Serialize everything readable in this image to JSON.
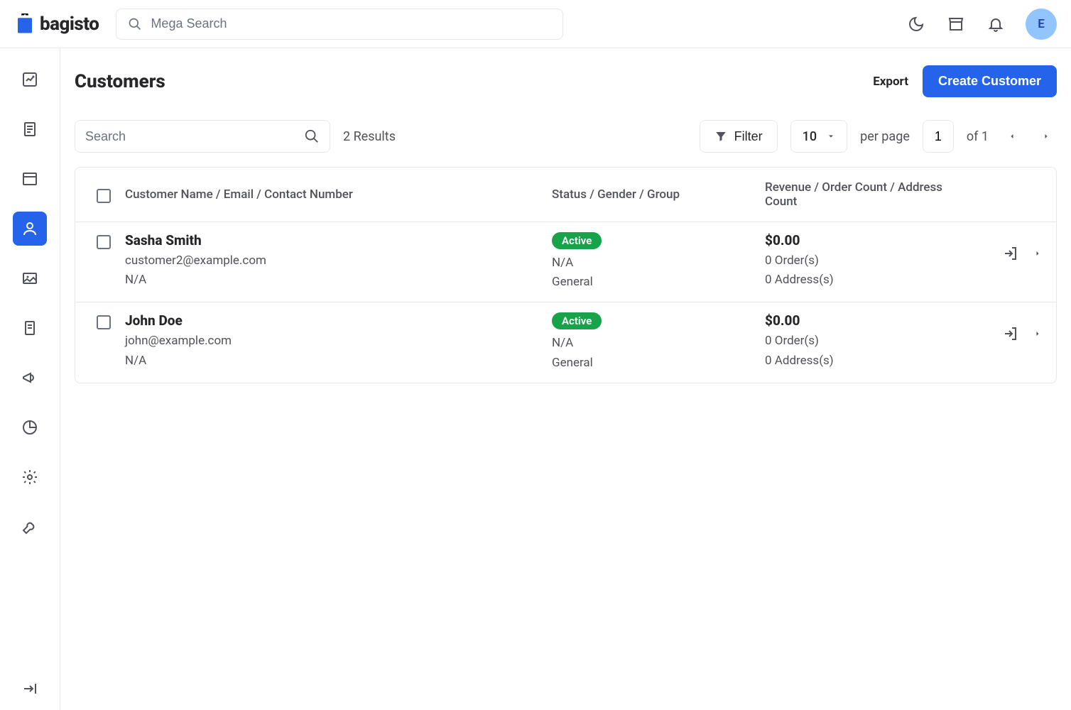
{
  "brand": "bagisto",
  "search": {
    "placeholder": "Mega Search"
  },
  "avatar_initial": "E",
  "page": {
    "title": "Customers"
  },
  "actions": {
    "export": "Export",
    "create": "Create Customer"
  },
  "toolbar": {
    "search_placeholder": "Search",
    "results": "2 Results",
    "filter": "Filter",
    "per_page_value": "10",
    "per_page_label": "per page",
    "page_current": "1",
    "of_label": "of",
    "page_total": "1"
  },
  "columns": {
    "name": "Customer Name / Email / Contact Number",
    "status": "Status / Gender / Group",
    "revenue": "Revenue / Order Count / Address Count"
  },
  "rows": [
    {
      "name": "Sasha Smith",
      "email": "customer2@example.com",
      "contact": "N/A",
      "status": "Active",
      "gender": "N/A",
      "group": "General",
      "revenue": "$0.00",
      "orders": "0 Order(s)",
      "addresses": "0 Address(s)"
    },
    {
      "name": "John Doe",
      "email": "john@example.com",
      "contact": "N/A",
      "status": "Active",
      "gender": "N/A",
      "group": "General",
      "revenue": "$0.00",
      "orders": "0 Order(s)",
      "addresses": "0 Address(s)"
    }
  ]
}
